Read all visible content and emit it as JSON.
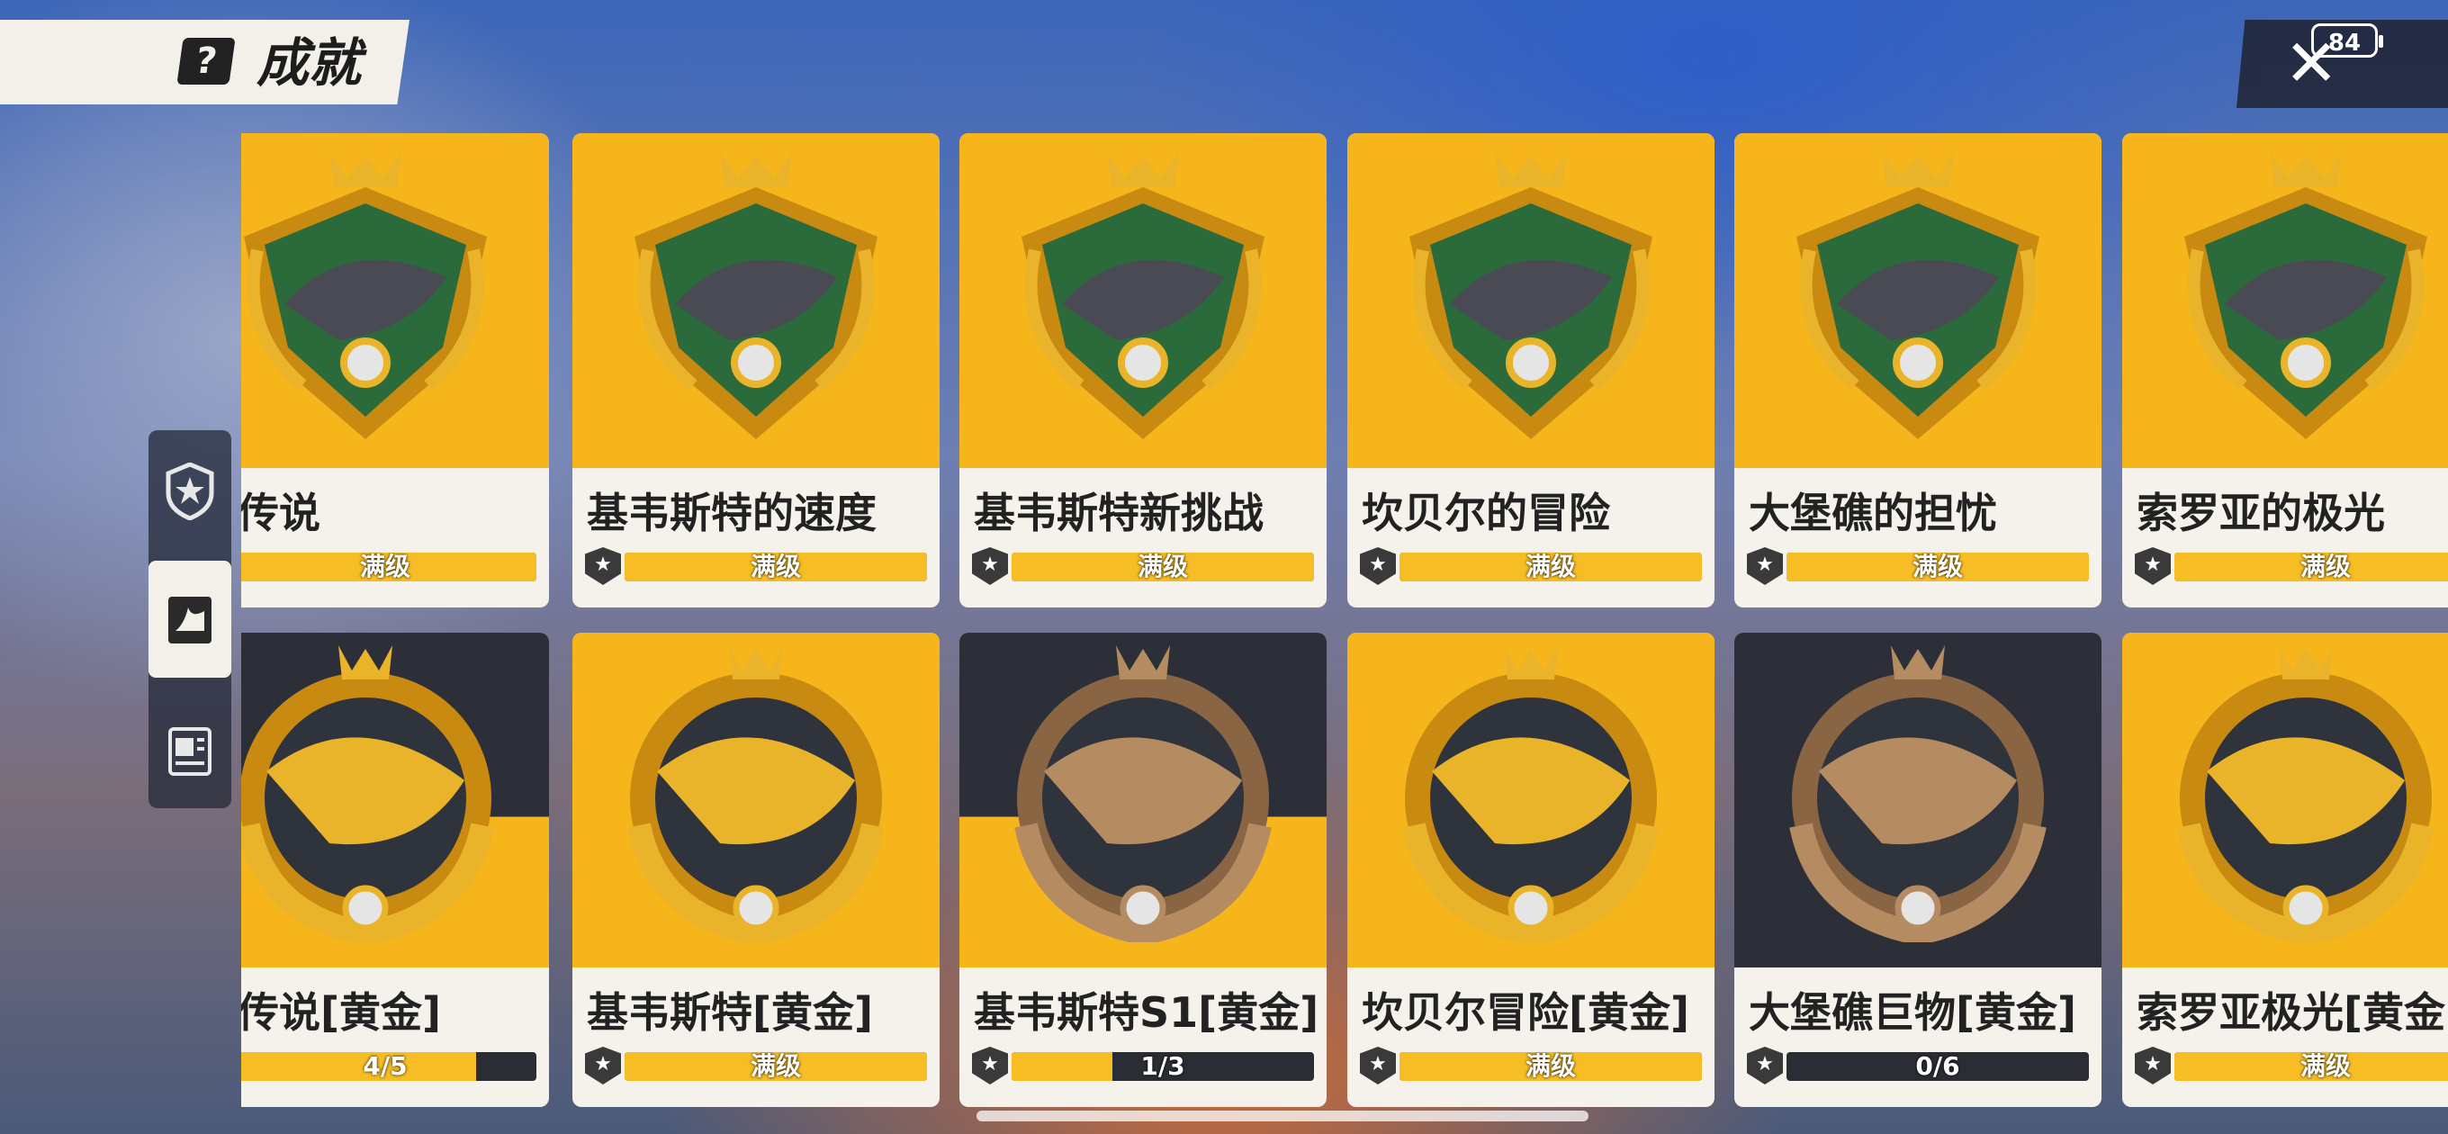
{
  "header": {
    "title": "成就",
    "title_icon": "question-box-icon",
    "close_icon": "close-icon",
    "battery": "84"
  },
  "side_nav": [
    {
      "name": "nav-star-badge",
      "icon": "star-shield-icon",
      "active": false
    },
    {
      "name": "nav-fish-book",
      "icon": "fish-book-icon",
      "active": true
    },
    {
      "name": "nav-journal",
      "icon": "journal-icon",
      "active": false
    }
  ],
  "colors": {
    "card_gold": "#f7b51c",
    "card_dark": "#2c2f38",
    "bar_fill": "#f7bd25",
    "bar_track": "#2b2d35",
    "card_body": "#f4f2ea"
  },
  "rows": [
    {
      "cards": [
        {
          "name": "湖传说",
          "status": "满级",
          "progress": 1.0,
          "art_bg": "gold",
          "badge_icon": "fish-crest-icon"
        },
        {
          "name": "基韦斯特的速度",
          "status": "满级",
          "progress": 1.0,
          "art_bg": "gold",
          "badge_icon": "swordfish-crest-icon"
        },
        {
          "name": "基韦斯特新挑战",
          "status": "满级",
          "progress": 1.0,
          "art_bg": "gold",
          "badge_icon": "white-marlin-crest-icon"
        },
        {
          "name": "坎贝尔的冒险",
          "status": "满级",
          "progress": 1.0,
          "art_bg": "gold",
          "badge_icon": "predator-fish-crest-icon"
        },
        {
          "name": "大堡礁的担忧",
          "status": "满级",
          "progress": 1.0,
          "art_bg": "gold",
          "badge_icon": "shark-crest-icon"
        },
        {
          "name": "索罗亚的极光",
          "status": "满级",
          "progress": 1.0,
          "art_bg": "gold",
          "badge_icon": "grey-shark-crest-icon"
        }
      ]
    },
    {
      "cards": [
        {
          "name": "湖传说[黄金]",
          "status": "4/5",
          "progress": 0.8,
          "art_bg": "split",
          "badge_icon": "gold-fish-medal-icon"
        },
        {
          "name": "基韦斯特[黄金]",
          "status": "满级",
          "progress": 1.0,
          "art_bg": "gold",
          "badge_icon": "gold-marlin-medal-icon"
        },
        {
          "name": "基韦斯特S1[黄金]",
          "status": "1/3",
          "progress": 0.333,
          "art_bg": "split",
          "badge_icon": "bronze-marlin-medal-icon"
        },
        {
          "name": "坎贝尔冒险[黄金]",
          "status": "满级",
          "progress": 1.0,
          "art_bg": "gold",
          "badge_icon": "gold-predator-medal-icon"
        },
        {
          "name": "大堡礁巨物[黄金]",
          "status": "0/6",
          "progress": 0.0,
          "art_bg": "dark",
          "badge_icon": "bronze-shark-medal-icon"
        },
        {
          "name": "索罗亚极光[黄金",
          "status": "满级",
          "progress": 1.0,
          "art_bg": "gold",
          "badge_icon": "gold-shark-medal-icon"
        }
      ]
    }
  ]
}
